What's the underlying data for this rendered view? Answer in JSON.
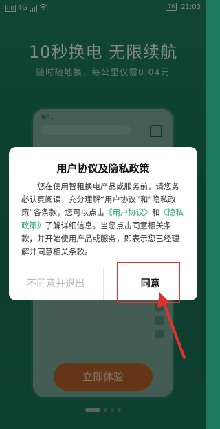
{
  "status_bar": {
    "network": "4G",
    "network2": "HD",
    "battery": "76",
    "time": "21:03"
  },
  "hero": {
    "headline": "10秒换电  无限续航",
    "subline": "随时随地换，每公里仅需0.04元"
  },
  "phone_preview": {
    "time": "9:41"
  },
  "dialog": {
    "title": "用户协议及隐私政策",
    "body_part1": "您在使用智租换电产品或服务前，请您务必认真阅读，充分理解“用户协议”和“隐私政策”各条款，您可以点击",
    "link_user_agreement": "《用户协议》",
    "body_and": "和",
    "link_privacy_policy": "《隐私政策》",
    "body_part2": "了解详细信息。当您点击同意相关条款，并开始使用产品或服务，即表示您已经理解并同意相关条款。",
    "decline_label": "不同意并退出",
    "agree_label": "同意"
  },
  "cta": {
    "label": "立即体验"
  },
  "colors": {
    "background": "#1a7656",
    "link": "#26a37a",
    "cta": "#b7622a",
    "highlight": "#e0332f"
  }
}
